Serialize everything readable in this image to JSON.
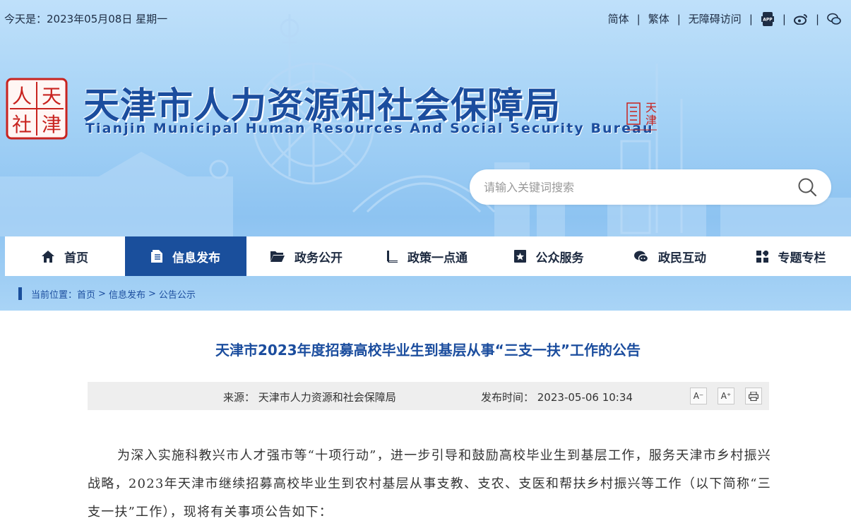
{
  "topbar": {
    "date": "今天是：2023年05月08日 星期一",
    "links": [
      "简体",
      "繁体",
      "无障碍访问"
    ],
    "icons": [
      "app-icon",
      "weibo-icon",
      "wechat-icon"
    ]
  },
  "logo": {
    "seal_chars": [
      "人",
      "天",
      "社",
      "津"
    ],
    "title_cn": "天津市人力资源和社会保障局",
    "title_en": "Tianjin Municipal Human Resources And Social Security Bureau",
    "tianjin_seal": "天津"
  },
  "search": {
    "placeholder": "请输入关键词搜索"
  },
  "nav": {
    "items": [
      {
        "label": "首页",
        "icon": "home-icon"
      },
      {
        "label": "信息发布",
        "icon": "document-icon",
        "active": true
      },
      {
        "label": "政务公开",
        "icon": "folder-icon"
      },
      {
        "label": "政策一点通",
        "icon": "book-icon"
      },
      {
        "label": "公众服务",
        "icon": "star-badge-icon"
      },
      {
        "label": "政民互动",
        "icon": "chat-icon"
      },
      {
        "label": "专题专栏",
        "icon": "grid-icon"
      }
    ]
  },
  "breadcrumb": {
    "prefix": "当前位置：",
    "items": [
      "首页",
      "信息发布",
      "公告公示"
    ],
    "separator": ">"
  },
  "article": {
    "title": "天津市2023年度招募高校毕业生到基层从事“三支一扶”工作的公告",
    "source": "来源： 天津市人力资源和社会保障局",
    "time": "发布时间： 2023-05-06 10:34",
    "tools": {
      "decrease": "A⁻",
      "increase": "A⁺",
      "print": "print-icon"
    },
    "paragraph": "为深入实施科教兴市人才强市等“十项行动”，进一步引导和鼓励高校毕业生到基层工作，服务天津市乡村振兴战略，2023年天津市继续招募高校毕业生到农村基层从事支教、支农、支医和帮扶乡村振兴等工作（以下简称“三支一扶”工作），现将有关事项公告如下："
  },
  "colors": {
    "brand": "#1a4f9c",
    "title": "#1b4d9e",
    "seal_red": "#c8231f"
  }
}
